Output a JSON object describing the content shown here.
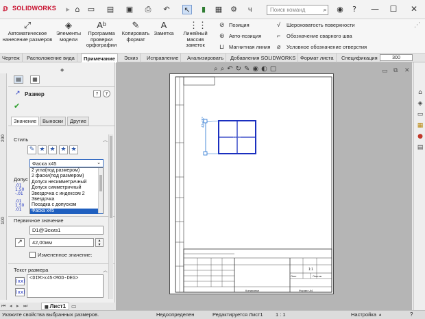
{
  "app": {
    "brand": "SOLIDWORKS"
  },
  "search": {
    "placeholder": "Поиск команд"
  },
  "quick_toolbar": {
    "dropdown_label": "Ч"
  },
  "ribbon": {
    "auto_dim": "Автоматическое нанесение размеров",
    "model_items": "Элементы модели",
    "spell_check": "Программа проверки орфографии",
    "copy_format": "Копировать формат",
    "note": "Заметка",
    "linear_pattern": "Линейный массив заметок",
    "balloon": "Позиция",
    "auto_balloon": "Авто-позиция",
    "magnetic_line": "Магнитная линия",
    "surface_finish": "Шероховатость поверхности",
    "weld_symbol": "Обозначение сварного шва",
    "hole_callout": "Условное обозначение отверстия"
  },
  "tabs": [
    "Чертеж",
    "Расположение вида",
    "Примечание",
    "Эскиз",
    "Исправление",
    "Анализировать",
    "Добавления SOLIDWORKS",
    "Формат листа",
    "Спецификация"
  ],
  "active_tab_index": 2,
  "zoom_ruler": "300",
  "pm": {
    "title": "Размер",
    "subtabs": [
      "Значение",
      "Выноски",
      "Другие"
    ],
    "style_group": "Стиль",
    "style_select": "Фаска х45",
    "style_options": [
      "2 угла(под размером)",
      "2 фаски(под размером)",
      "Допуск несимметричный",
      "Допуск симметричный",
      "Звездочка с индексом 2",
      "Звездочка",
      "Посадка с допуском",
      "Фаска х45"
    ],
    "tolerance_group": "Допус",
    "primary_group": "Первичное значение",
    "primary_ref": "D1@Эскиз1",
    "primary_value": "42,00мм",
    "override_label": "Измененное значение:",
    "dim_text_group": "Текст размера",
    "dim_text": "<DIM>x45<MOD-DEG>"
  },
  "sheet_tab": "Лист1",
  "vruler_labels": [
    "200",
    "100"
  ],
  "status": {
    "hint": "Укажите свойства выбранных размеров.",
    "defined": "Недоопределен",
    "editing": "Редактируется Лист1",
    "scale": "1 : 1",
    "settings": "Настройка"
  },
  "title_block": {
    "scale": "1:1",
    "sheet": "Лист",
    "sheets": "Листов",
    "format": "Формат А4",
    "copied": "Копировал"
  },
  "colors": {
    "accent": "#c8102e",
    "sketch": "#1a2fbf",
    "selection": "#1f5fbf"
  }
}
